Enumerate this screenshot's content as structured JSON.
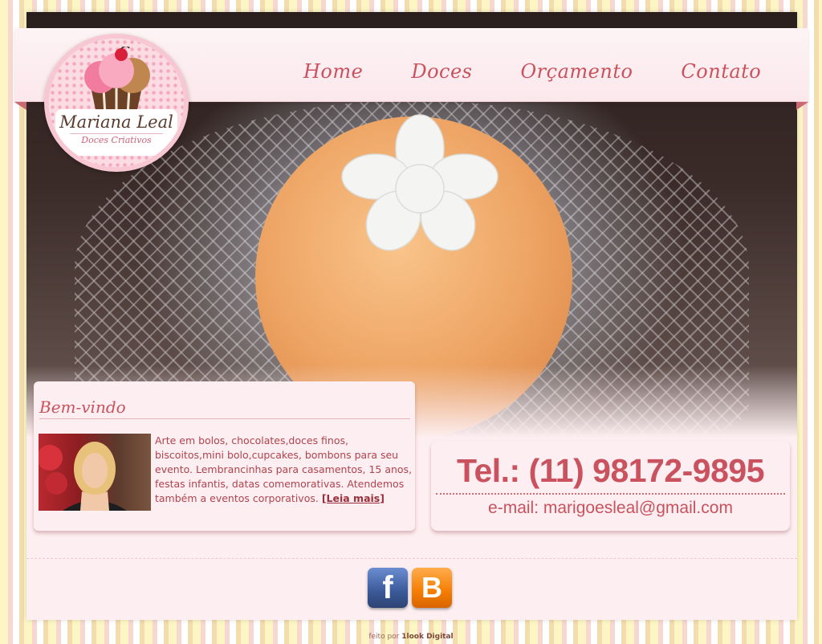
{
  "nav": {
    "items": [
      {
        "label": "Home"
      },
      {
        "label": "Doces"
      },
      {
        "label": "Orçamento"
      },
      {
        "label": "Contato"
      }
    ]
  },
  "logo": {
    "name": "Mariana Leal",
    "subtitle": "Doces Criativos"
  },
  "welcome": {
    "title": "Bem-vindo",
    "text": "Arte em bolos, chocolates,doces finos, biscoitos,mini bolo,cupcakes, bombons para seu evento. Lembrancinhas para casamentos, 15 anos, festas infantis, datas comemorativas. Atendemos também a eventos corporativos.",
    "read_more": "[Leia mais]"
  },
  "contact": {
    "phone": "Tel.: (11) 98172-9895",
    "email": "e-mail: marigoesleal@gmail.com"
  },
  "social": {
    "facebook_icon": "facebook-icon",
    "blogger_icon": "blogger-icon",
    "facebook_glyph": "f",
    "blogger_glyph": "B"
  },
  "footer": {
    "prefix": "feito por",
    "brand": "1look Digital"
  },
  "colors": {
    "accent": "#c9525e",
    "panel": "#fdeef1"
  }
}
